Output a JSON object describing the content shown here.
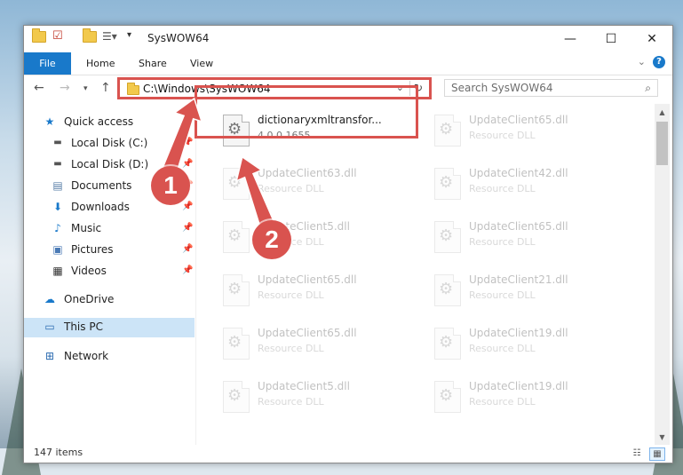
{
  "window": {
    "title": "SysWOW64",
    "controls": {
      "minimize": "—",
      "maximize": "☐",
      "close": "✕"
    }
  },
  "ribbon": {
    "file_tab": "File",
    "tabs": [
      "Home",
      "Share",
      "View"
    ],
    "help": "?"
  },
  "nav": {
    "address": "C:\\Windows\\SysWOW64",
    "search_placeholder": "Search SysWOW64"
  },
  "sidebar": {
    "items": [
      {
        "label": "Quick access",
        "icon": "star-icon",
        "pinned": false
      },
      {
        "label": "Local Disk (C:)",
        "icon": "drive-icon",
        "pinned": true
      },
      {
        "label": "Local Disk (D:)",
        "icon": "drive-icon",
        "pinned": true
      },
      {
        "label": "Documents",
        "icon": "documents-icon",
        "pinned": true
      },
      {
        "label": "Downloads",
        "icon": "download-icon",
        "pinned": true
      },
      {
        "label": "Music",
        "icon": "music-icon",
        "pinned": true
      },
      {
        "label": "Pictures",
        "icon": "pictures-icon",
        "pinned": true
      },
      {
        "label": "Videos",
        "icon": "videos-icon",
        "pinned": true
      },
      {
        "label": "OneDrive",
        "icon": "cloud-icon",
        "pinned": false
      },
      {
        "label": "This PC",
        "icon": "computer-icon",
        "pinned": false,
        "selected": true
      },
      {
        "label": "Network",
        "icon": "network-icon",
        "pinned": false
      }
    ]
  },
  "files": [
    {
      "name": "dictionaryxmltransfor...",
      "sub": "4.0.0.1655",
      "highlight": true
    },
    {
      "name": "UpdateClient65.dll",
      "sub": "Resource DLL"
    },
    {
      "name": "UpdateClient63.dll",
      "sub": "Resource DLL"
    },
    {
      "name": "UpdateClient42.dll",
      "sub": "Resource DLL"
    },
    {
      "name": "UpdateClient5.dll",
      "sub": "Resource DLL"
    },
    {
      "name": "UpdateClient65.dll",
      "sub": "Resource DLL"
    },
    {
      "name": "UpdateClient65.dll",
      "sub": "Resource DLL"
    },
    {
      "name": "UpdateClient21.dll",
      "sub": "Resource DLL"
    },
    {
      "name": "UpdateClient65.dll",
      "sub": "Resource DLL"
    },
    {
      "name": "UpdateClient19.dll",
      "sub": "Resource DLL"
    },
    {
      "name": "UpdateClient5.dll",
      "sub": "Resource DLL"
    },
    {
      "name": "UpdateClient19.dll",
      "sub": "Resource DLL"
    }
  ],
  "status": {
    "items_count": "147 items"
  },
  "annotations": {
    "step1": "1",
    "step2": "2",
    "color": "#d9534f"
  }
}
